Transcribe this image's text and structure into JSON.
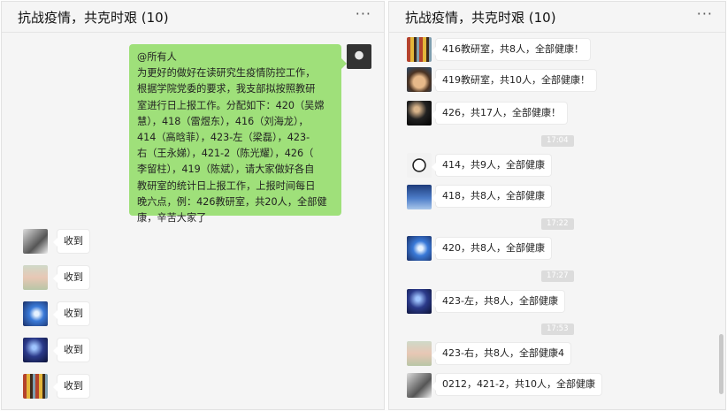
{
  "left_chat": {
    "title": "抗战疫情，共克时艰 (10)",
    "more": "···",
    "announcement": {
      "lines": [
        "@所有人",
        "为更好的做好在读研究生疫情防控工作，",
        "根据学院党委的要求，我支部拟按照教研",
        "室进行日上报工作。分配如下：420（吴嫦",
        "慧），418（雷煜东），416（刘海龙），",
        "414（高晗菲），423-左（梁磊），423-",
        "右（王永娣），421-2（陈光耀），426（",
        "李留柱），419（陈斌），请大家做好各自",
        "教研室的统计日上报工作，上报时间每日",
        "晚六点，例：426教研室，共20人，全部健",
        "康，辛苦大家了"
      ]
    },
    "replies": [
      {
        "text": "收到",
        "avatar": "dark-sketch"
      },
      {
        "text": "收到",
        "avatar": "outdoor-photo"
      },
      {
        "text": "收到",
        "avatar": "blue-light"
      },
      {
        "text": "收到",
        "avatar": "night-sky"
      },
      {
        "text": "收到",
        "avatar": "colorful-stripes"
      }
    ]
  },
  "right_chat": {
    "title": "抗战疫情，共克时艰 (10)",
    "more": "···",
    "messages": [
      {
        "text": "416教研室，共8人，全部健康！",
        "avatar": "colorful-stripes"
      },
      {
        "text": "419教研室，共10人，全部健康！",
        "avatar": "anime-portrait"
      },
      {
        "text": "426，共17人，全部健康！",
        "avatar": "dark-figure"
      },
      {
        "text": "414，共9人，全部健康",
        "avatar": "cartoon-face"
      },
      {
        "text": "418，共8人，全部健康",
        "avatar": "blue-water"
      },
      {
        "text": "420，共8人，全部健康",
        "avatar": "blue-light"
      },
      {
        "text": "423-左，共8人，全部健康",
        "avatar": "night-sky"
      },
      {
        "text": "423-右，共8人，全部健康4",
        "avatar": "outdoor-photo"
      },
      {
        "text": "0212，421-2，共10人，全部健康",
        "avatar": "dark-sketch"
      }
    ],
    "timestamps": [
      "17:04",
      "17:22",
      "17:27",
      "17:53"
    ]
  },
  "colors": {
    "green_bubble": "#9fe07a",
    "panel_bg": "#f5f5f5",
    "time_bg": "#dcdcdc"
  }
}
